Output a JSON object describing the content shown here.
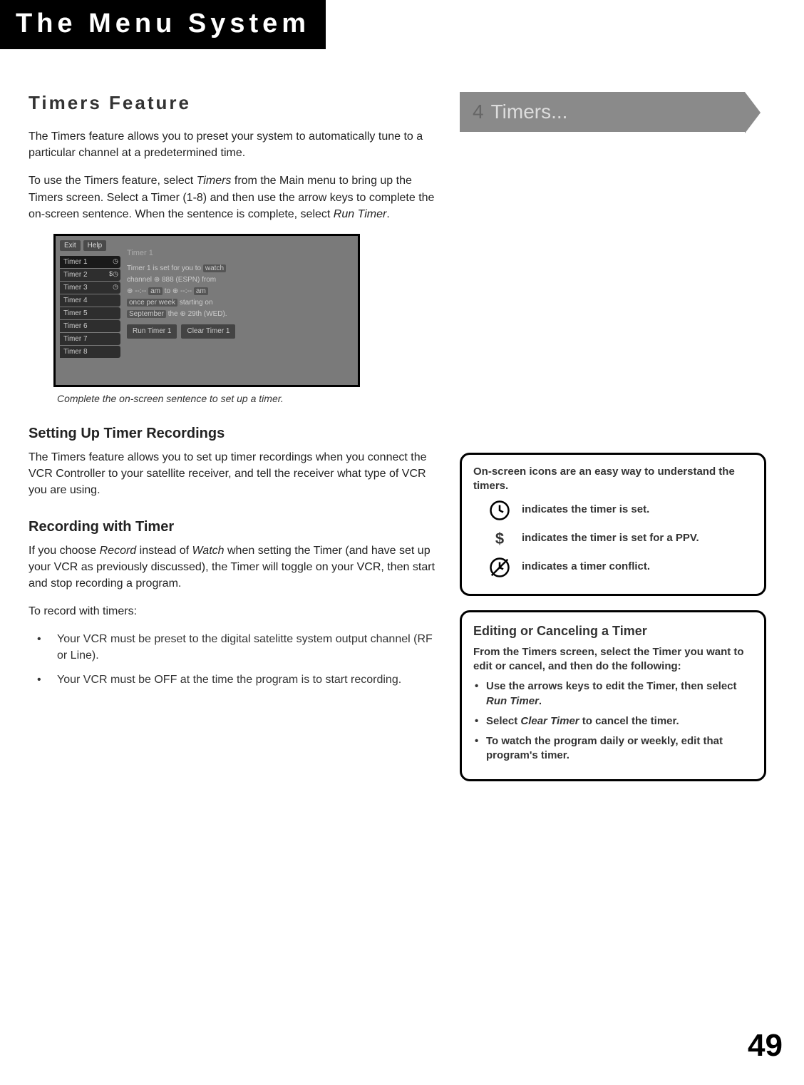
{
  "chapter_header": "The Menu System",
  "section_title": "Timers Feature",
  "intro_p1": "The Timers feature allows you to preset your system to automatically tune to a particular channel at a predetermined time.",
  "intro_p2_a": "To use the Timers feature, select ",
  "intro_p2_i1": "Timers",
  "intro_p2_b": " from the Main menu to bring up the Timers screen. Select a Timer (1-8) and then use the arrow keys to complete the on-screen sentence. When the sentence is complete, select ",
  "intro_p2_i2": "Run Timer",
  "intro_p2_c": ".",
  "screenshot_caption": "Complete the on-screen sentence to set up a timer.",
  "tv": {
    "exit": "Exit",
    "help": "Help",
    "title": "Timer 1",
    "tabs": [
      "Timer 1",
      "Timer 2",
      "Timer 3",
      "Timer 4",
      "Timer 5",
      "Timer 6",
      "Timer 7",
      "Timer 8"
    ],
    "sentence": {
      "l1a": "Timer 1 is set for you to ",
      "l1h": "watch",
      "l2a": "channel ",
      "l2ch": "888",
      "l2b": " (ESPN) from",
      "l3a": "--:-- ",
      "l3h1": "am",
      "l3b": " to ",
      "l3h2": "am",
      "l4h": "once per week",
      "l4b": " starting on",
      "l5h": "September",
      "l5b": " the ",
      "l5c": "29th (WED)."
    },
    "run": "Run Timer 1",
    "clear": "Clear Timer 1"
  },
  "sub1_title": "Setting Up Timer Recordings",
  "sub1_p": "The Timers feature allows you to set up timer recordings when you connect the VCR Controller to your satellite receiver, and tell the receiver what type of VCR you are using.",
  "sub2_title": "Recording with Timer",
  "sub2_p1_a": "If you choose ",
  "sub2_p1_i1": "Record",
  "sub2_p1_b": " instead of ",
  "sub2_p1_i2": "Watch",
  "sub2_p1_c": " when setting the Timer (and have set up your VCR as previously discussed), the Timer will toggle on your VCR, then start and stop recording a program.",
  "sub2_p2": "To record with timers:",
  "sub2_b1": "Your VCR must be preset to the digital satelitte system output channel (RF or Line).",
  "sub2_b2": "Your VCR must be OFF at the time the program is to start recording.",
  "banner_num": "4",
  "banner_text": "Timers...",
  "callout1": {
    "lead": "On-screen icons are an easy way to understand the timers.",
    "i1": "indicates the timer is set.",
    "i2": "indicates the timer is set for a PPV.",
    "i3": "indicates a timer conflict."
  },
  "callout2": {
    "title": "Editing or Canceling a Timer",
    "lead": "From the Timers screen, select the Timer you want to edit or cancel, and then do the following:",
    "b1a": "Use the arrows keys to edit the Timer, then select ",
    "b1i": "Run Timer",
    "b1b": ".",
    "b2a": "Select ",
    "b2i": "Clear Timer",
    "b2b": " to cancel the timer.",
    "b3": "To watch the program daily or weekly, edit that program's timer."
  },
  "page_number": "49"
}
